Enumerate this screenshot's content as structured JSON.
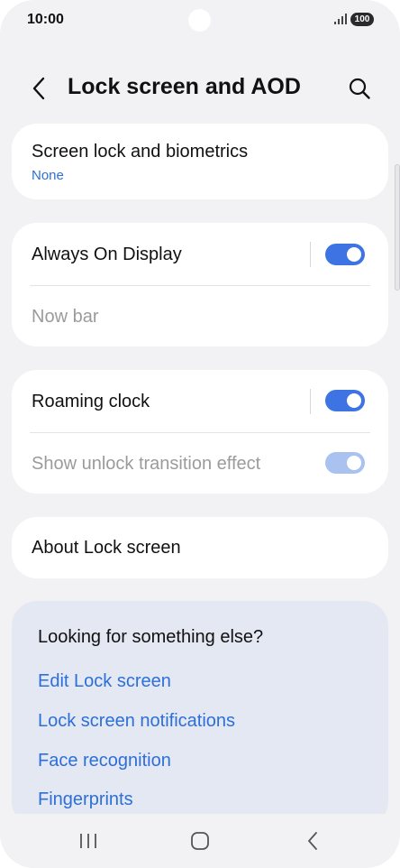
{
  "status_bar": {
    "time": "10:00",
    "battery": "100"
  },
  "header": {
    "title": "Lock screen and AOD",
    "back_icon": "chevron-left-icon",
    "search_icon": "search-icon"
  },
  "sections": {
    "screen_lock": {
      "title": "Screen lock and biometrics",
      "value": "None"
    },
    "aod": {
      "title": "Always On Display",
      "toggle_on": true,
      "sub_item": "Now bar"
    },
    "roaming": {
      "title": "Roaming clock",
      "toggle_on": true,
      "unlock_effect": "Show unlock transition effect",
      "unlock_effect_on": true
    },
    "about": {
      "title": "About Lock screen"
    }
  },
  "suggestions": {
    "title": "Looking for something else?",
    "links": [
      "Edit Lock screen",
      "Lock screen notifications",
      "Face recognition",
      "Fingerprints"
    ]
  },
  "colors": {
    "accent": "#3e73e3",
    "link": "#2c6fd8",
    "background": "#f2f2f4",
    "card": "#ffffff",
    "suggest_background": "#e4e8f3"
  },
  "navbar": {
    "recents_icon": "recents-icon",
    "home_icon": "home-icon",
    "back_icon": "back-icon"
  }
}
